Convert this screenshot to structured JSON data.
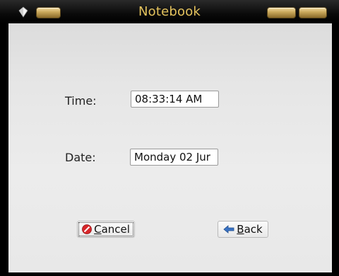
{
  "window": {
    "title": "Notebook"
  },
  "form": {
    "time_label": "Time:",
    "time_value": "08:33:14 AM",
    "date_label": "Date:",
    "date_value": "Monday 02 Jur"
  },
  "buttons": {
    "cancel": {
      "mnemonic": "C",
      "rest": "ancel",
      "icon": "cancel-icon"
    },
    "back": {
      "mnemonic": "B",
      "rest": "ack",
      "icon": "back-arrow-icon"
    }
  },
  "colors": {
    "title": "#e3c25d",
    "titlebar": "#000000",
    "client_bg": "#e6e6e6",
    "cancel_icon": "#d8262a",
    "back_icon": "#3a73c4"
  }
}
